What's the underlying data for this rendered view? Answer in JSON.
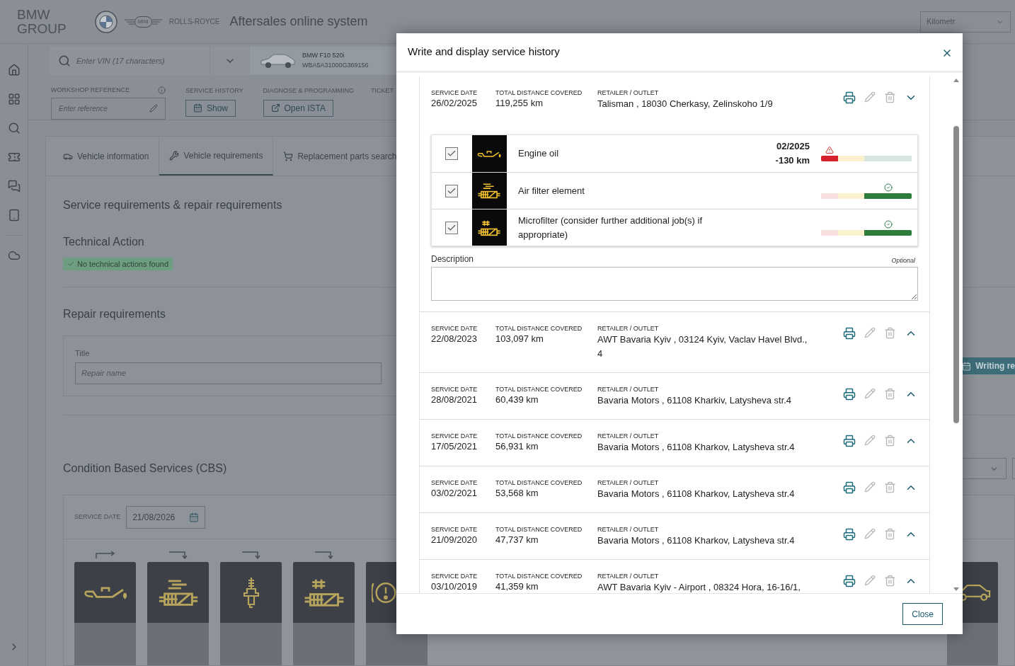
{
  "header": {
    "logo_lines": [
      "BMW",
      "GROUP"
    ],
    "mini_mark": "MINI",
    "rolls_mark": "ROLLS-ROYCE",
    "title": "Aftersales online system",
    "unit_select": "Kilometr"
  },
  "vin_search": {
    "placeholder": "Enter VIN (17 characters)"
  },
  "vehicle_tab": {
    "model": "BMW F10 520i",
    "vin": "WBA5A31000G369156"
  },
  "toolbar": {
    "reference_label": "WORKSHOP REFERENCE",
    "reference_placeholder": "Enter reference",
    "history_label": "SERVICE HISTORY",
    "history_button": "Show",
    "diagnose_label": "DIAGNOSE & PROGRAMMING",
    "diagnose_button": "Open ISTA",
    "tickets_label": "TICKET"
  },
  "tabs": [
    {
      "label": "Vehicle information",
      "kind": "car",
      "selected": false
    },
    {
      "label": "Vehicle requirements",
      "kind": "tools",
      "selected": true
    },
    {
      "label": "Replacement parts search",
      "kind": "cart",
      "selected": false
    }
  ],
  "requirements": {
    "heading": "Service requirements & repair requirements",
    "technical_heading": "Technical Action",
    "technical_badge": "No technical actions found",
    "repair_heading": "Repair requirements",
    "title_label": "Title",
    "title_placeholder": "Repair name",
    "writing_button": "Writing re"
  },
  "cbs": {
    "heading": "Condition Based Services (CBS)",
    "date_label": "SERVICE DATE",
    "date_value": "21/08/2026",
    "tiles": [
      {
        "kind": "oil"
      },
      {
        "kind": "air_filter"
      },
      {
        "kind": "spark_plug"
      },
      {
        "kind": "microfilter"
      },
      {
        "kind": "brake"
      }
    ],
    "right_tile": {
      "kind": "car"
    }
  },
  "modal": {
    "title": "Write and display service history",
    "close_button": "Close",
    "records": [
      {
        "date_label": "SERVICE DATE",
        "date": "26/02/2025",
        "distance_label": "TOTAL DISTANCE COVERED",
        "distance": "119,255 km",
        "retailer_label": "RETAILER / OUTLET",
        "retailer": "Talisman , 18030 Cherkasy, Zelinskoho 1/9",
        "expanded": true,
        "items": [
          {
            "kind": "oil",
            "name": "Engine oil",
            "checked": true,
            "due_date": "02/2025",
            "due_distance": "-130 km",
            "overdue": true
          },
          {
            "kind": "air_filter",
            "name": "Air filter element",
            "checked": true,
            "overdue": false
          },
          {
            "kind": "microfilter",
            "name": "Microfilter (consider further additional job(s) if appropriate)",
            "checked": true,
            "overdue": false
          }
        ],
        "description_label": "Description",
        "description_hint": "Optional"
      },
      {
        "date_label": "SERVICE DATE",
        "date": "22/08/2023",
        "distance_label": "TOTAL DISTANCE COVERED",
        "distance": "103,097 km",
        "retailer_label": "RETAILER / OUTLET",
        "retailer": "AWT Bavaria Kyiv , 03124 Kyiv, Vaclav Havel Blvd., 4",
        "expanded": false
      },
      {
        "date_label": "SERVICE DATE",
        "date": "28/08/2021",
        "distance_label": "TOTAL DISTANCE COVERED",
        "distance": "60,439 km",
        "retailer_label": "RETAILER / OUTLET",
        "retailer": "Bavaria Motors , 61108 Kharkiv, Latysheva str.4",
        "expanded": false
      },
      {
        "date_label": "SERVICE DATE",
        "date": "17/05/2021",
        "distance_label": "TOTAL DISTANCE COVERED",
        "distance": "56,931 km",
        "retailer_label": "RETAILER / OUTLET",
        "retailer": "Bavaria Motors , 61108 Kharkov, Latysheva str.4",
        "expanded": false
      },
      {
        "date_label": "SERVICE DATE",
        "date": "03/02/2021",
        "distance_label": "TOTAL DISTANCE COVERED",
        "distance": "53,568 km",
        "retailer_label": "RETAILER / OUTLET",
        "retailer": "Bavaria Motors , 61108 Kharkov, Latysheva str.4",
        "expanded": false
      },
      {
        "date_label": "SERVICE DATE",
        "date": "21/09/2020",
        "distance_label": "TOTAL DISTANCE COVERED",
        "distance": "47,737 km",
        "retailer_label": "RETAILER / OUTLET",
        "retailer": "Bavaria Motors , 61108 Kharkov, Latysheva str.4",
        "expanded": false
      },
      {
        "date_label": "SERVICE DATE",
        "date": "03/10/2019",
        "distance_label": "TOTAL DISTANCE COVERED",
        "distance": "41,359 km",
        "retailer_label": "RETAILER / OUTLET",
        "retailer": "AWT Bavaria Kyiv - Airport , 08324 Hora, 16-16/1,",
        "expanded": false
      }
    ]
  }
}
